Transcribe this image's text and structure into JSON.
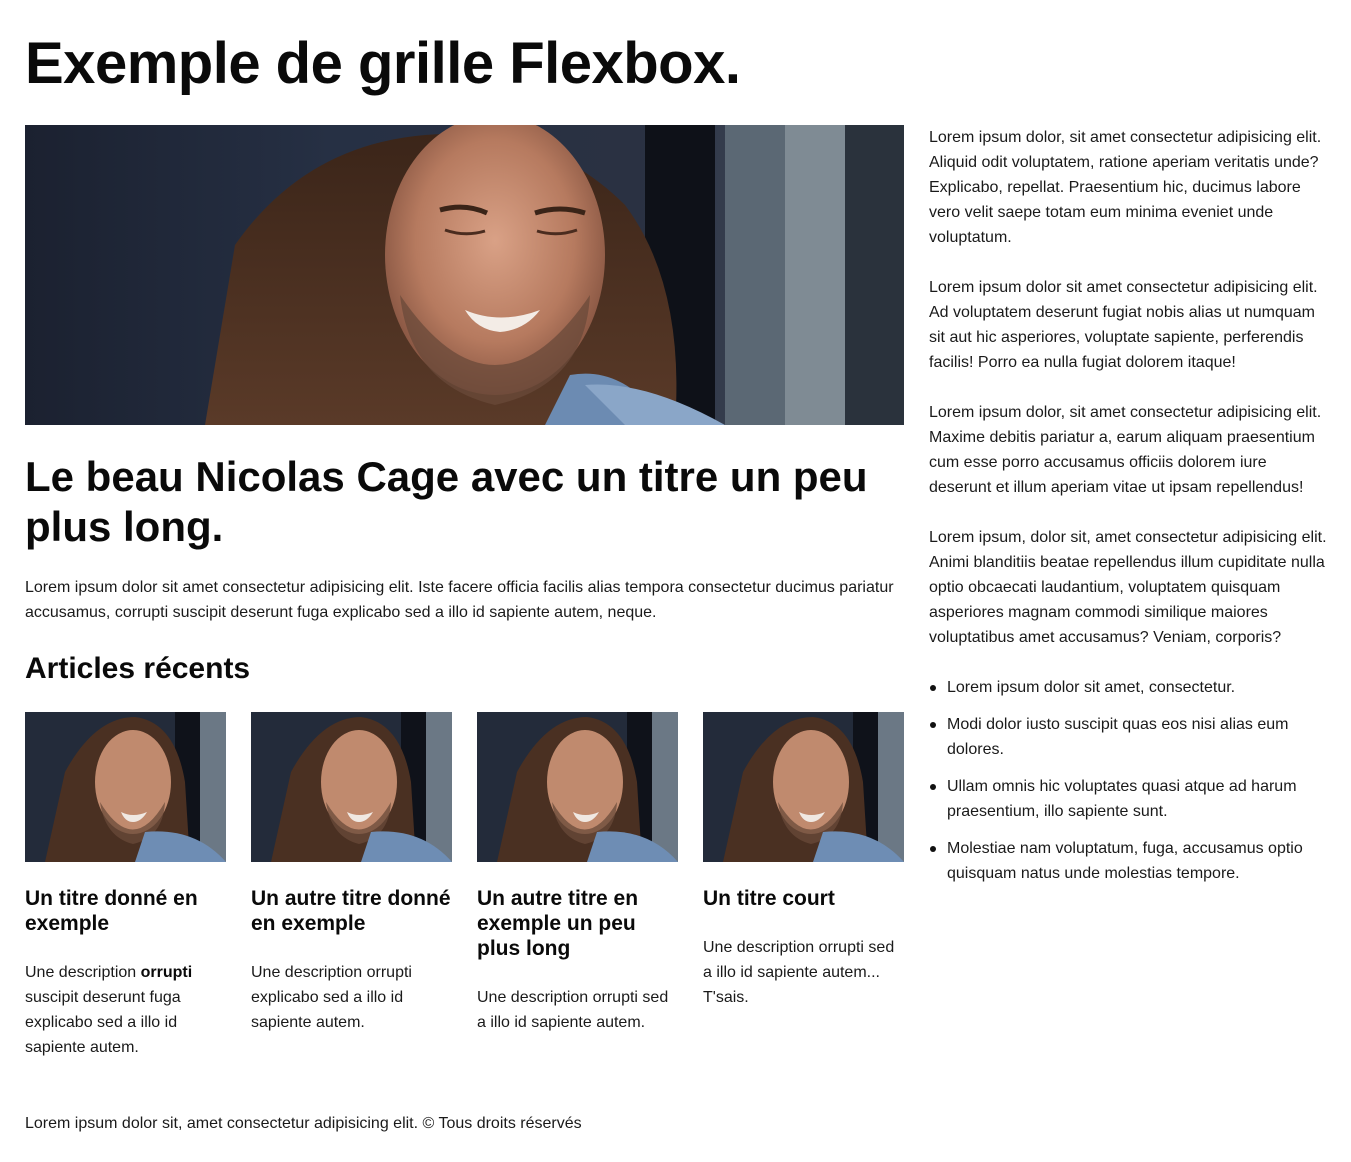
{
  "page": {
    "title": "Exemple de grille Flexbox."
  },
  "main": {
    "hero_image_alt": "Nicolas Cage",
    "article_title": "Le beau Nicolas Cage avec un titre un peu plus long.",
    "article_body": "Lorem ipsum dolor sit amet consectetur adipisicing elit. Iste facere officia facilis alias tempora consectetur ducimus pariatur accusamus, corrupti suscipit deserunt fuga explicabo sed a illo id sapiente autem, neque.",
    "section_title": "Articles récents"
  },
  "cards": [
    {
      "title": "Un titre donné en exemple",
      "desc_before": "Une description ",
      "desc_bold": "orrupti",
      "desc_after": " suscipit deserunt fuga explicabo sed a illo id sapiente autem."
    },
    {
      "title": "Un autre titre donné en exemple",
      "desc": "Une description orrupti explicabo sed a illo id sapiente autem."
    },
    {
      "title": "Un autre titre en exemple un peu plus long",
      "desc": "Une description orrupti sed a illo id sapiente autem."
    },
    {
      "title": "Un titre court",
      "desc": "Une description orrupti sed a illo id sapiente autem... T'sais."
    }
  ],
  "sidebar": {
    "paragraphs": [
      "Lorem ipsum dolor, sit amet consectetur adipisicing elit. Aliquid odit voluptatem, ratione aperiam veritatis unde? Explicabo, repellat. Praesentium hic, ducimus labore vero velit saepe totam eum minima eveniet unde voluptatum.",
      "Lorem ipsum dolor sit amet consectetur adipisicing elit. Ad voluptatem deserunt fugiat nobis alias ut numquam sit aut hic asperiores, voluptate sapiente, perferendis facilis! Porro ea nulla fugiat dolorem itaque!",
      "Lorem ipsum dolor, sit amet consectetur adipisicing elit. Maxime debitis pariatur a, earum aliquam praesentium cum esse porro accusamus officiis dolorem iure deserunt et illum aperiam vitae ut ipsam repellendus!",
      "Lorem ipsum, dolor sit, amet consectetur adipisicing elit. Animi blanditiis beatae repellendus illum cupiditate nulla optio obcaecati laudantium, voluptatem quisquam asperiores magnam commodi similique maiores voluptatibus amet accusamus? Veniam, corporis?"
    ],
    "list": [
      "Lorem ipsum dolor sit amet, consectetur.",
      "Modi dolor iusto suscipit quas eos nisi alias eum dolores.",
      "Ullam omnis hic voluptates quasi atque ad harum praesentium, illo sapiente sunt.",
      "Molestiae nam voluptatum, fuga, accusamus optio quisquam natus unde molestias tempore."
    ]
  },
  "footer": {
    "text": "Lorem ipsum dolor sit, amet consectetur adipisicing elit. © Tous droits réservés"
  }
}
